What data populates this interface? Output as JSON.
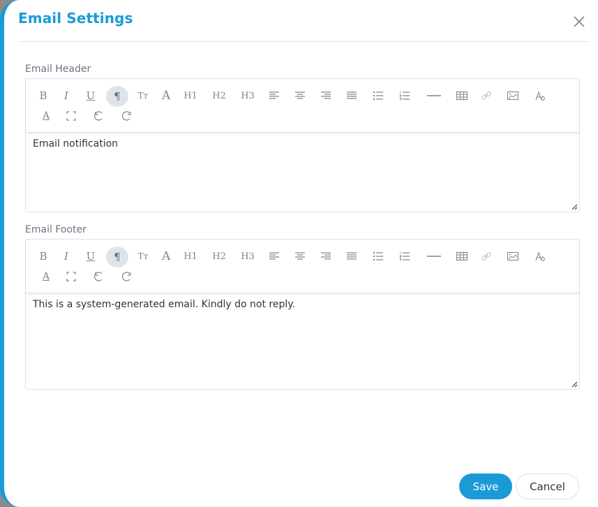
{
  "dialog": {
    "title": "Email Settings",
    "close_label": "Close",
    "accent_color": "#1a9bd7"
  },
  "toolbar_items": [
    {
      "name": "bold",
      "glyph": "B"
    },
    {
      "name": "italic",
      "glyph": "I"
    },
    {
      "name": "underline",
      "glyph": "U"
    },
    {
      "name": "paragraph",
      "glyph": "¶",
      "active": true
    },
    {
      "name": "font-size",
      "glyph": "Tт"
    },
    {
      "name": "font",
      "glyph": "A"
    },
    {
      "name": "heading-1",
      "glyph": "H1"
    },
    {
      "name": "heading-2",
      "glyph": "H2"
    },
    {
      "name": "heading-3",
      "glyph": "H3"
    },
    {
      "name": "align-left",
      "glyph": ""
    },
    {
      "name": "align-center",
      "glyph": ""
    },
    {
      "name": "align-right",
      "glyph": ""
    },
    {
      "name": "align-justify",
      "glyph": ""
    },
    {
      "name": "bullet-list",
      "glyph": ""
    },
    {
      "name": "numbered-list",
      "glyph": ""
    },
    {
      "name": "horizontal-rule",
      "glyph": ""
    },
    {
      "name": "table",
      "glyph": ""
    },
    {
      "name": "link",
      "glyph": ""
    },
    {
      "name": "image",
      "glyph": ""
    },
    {
      "name": "text-color",
      "glyph": ""
    },
    {
      "name": "background-color",
      "glyph": "A"
    },
    {
      "name": "fullscreen",
      "glyph": ""
    },
    {
      "name": "undo",
      "glyph": ""
    },
    {
      "name": "redo",
      "glyph": ""
    }
  ],
  "header_editor": {
    "label": "Email Header",
    "content": "Email notification"
  },
  "footer_editor": {
    "label": "Email Footer",
    "content": "This is a system-generated email. Kindly do not reply."
  },
  "actions": {
    "save_label": "Save",
    "cancel_label": "Cancel"
  }
}
